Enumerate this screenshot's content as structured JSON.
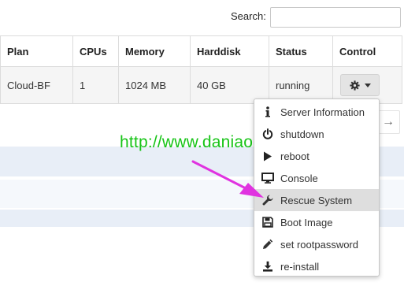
{
  "search": {
    "label": "Search:",
    "value": ""
  },
  "table": {
    "headers": [
      "Plan",
      "CPUs",
      "Memory",
      "Harddisk",
      "Status",
      "Control"
    ],
    "rows": [
      {
        "plan": "Cloud-BF",
        "cpus": "1",
        "memory": "1024 MB",
        "harddisk": "40 GB",
        "status": "running"
      }
    ]
  },
  "pagination": {
    "next_glyph": "→"
  },
  "watermark": "http://www.daniao.org",
  "control_menu": {
    "items": [
      {
        "label": "Server Information",
        "icon": "info-icon"
      },
      {
        "label": "shutdown",
        "icon": "power-icon"
      },
      {
        "label": "reboot",
        "icon": "play-icon"
      },
      {
        "label": "Console",
        "icon": "monitor-icon"
      },
      {
        "label": "Rescue System",
        "icon": "wrench-icon",
        "active": true
      },
      {
        "label": "Boot Image",
        "icon": "floppy-icon"
      },
      {
        "label": "set rootpassword",
        "icon": "pencil-icon"
      },
      {
        "label": "re-install",
        "icon": "download-icon"
      }
    ]
  },
  "colors": {
    "watermark": "#17c417",
    "arrow": "#e033e0",
    "menu_active_bg": "#dedede"
  }
}
